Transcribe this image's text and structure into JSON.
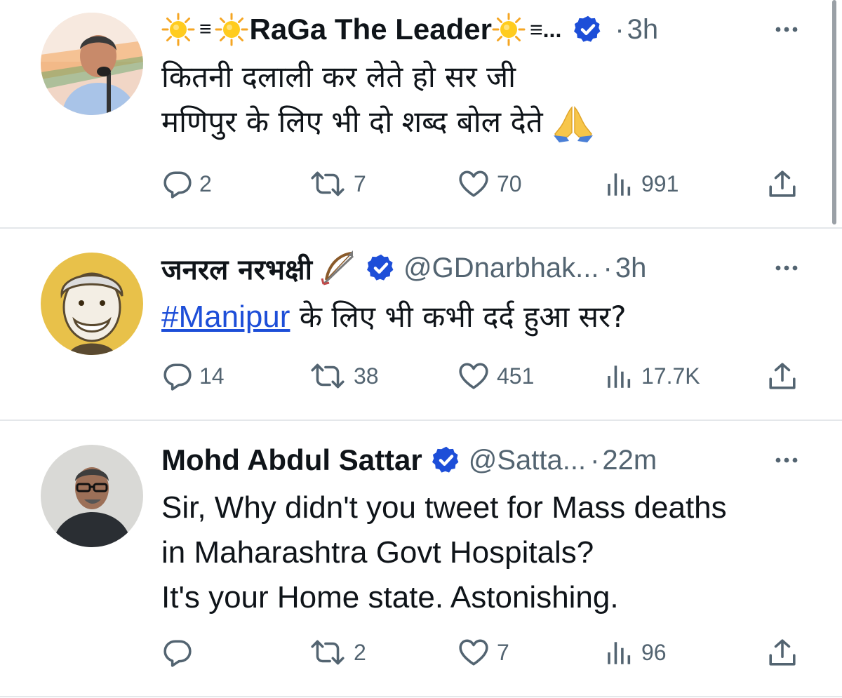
{
  "tweets": [
    {
      "display_name": "RaGa The Leader",
      "name_prefix": "≡",
      "name_suffix": "≡...",
      "handle": "",
      "time": "3h",
      "lines": [
        "कितनी दलाली कर लेते हो सर जी",
        "मणिपुर के लिए भी दो शब्द बोल देते"
      ],
      "replies": "2",
      "retweets": "7",
      "likes": "70",
      "views": "991"
    },
    {
      "display_name": "जनरल नरभक्षी",
      "handle": "@GDnarbhak...",
      "time": "3h",
      "hashtag": "#Manipur",
      "line_rest": " के लिए भी कभी दर्द हुआ सर?",
      "replies": "14",
      "retweets": "38",
      "likes": "451",
      "views": "17.7K"
    },
    {
      "display_name": "Mohd Abdul Sattar",
      "handle": "@Satta...",
      "time": "22m",
      "lines": [
        "Sir, Why didn't you tweet for Mass deaths",
        "in Maharashtra Govt Hospitals?",
        "It's your Home state. Astonishing."
      ],
      "replies": "",
      "retweets": "2",
      "likes": "7",
      "views": "96"
    }
  ],
  "separator": "·",
  "colors": {
    "text": "#0f1419",
    "secondary": "#536471",
    "verified": "#1d4ed8",
    "link": "#1d4ed8",
    "divider": "#e4e7ea"
  },
  "icons": [
    "sun-icon",
    "pray-hands-icon",
    "bow-arrow-icon",
    "verified-badge-icon",
    "more-icon",
    "reply-icon",
    "retweet-icon",
    "like-icon",
    "views-icon",
    "share-icon"
  ]
}
